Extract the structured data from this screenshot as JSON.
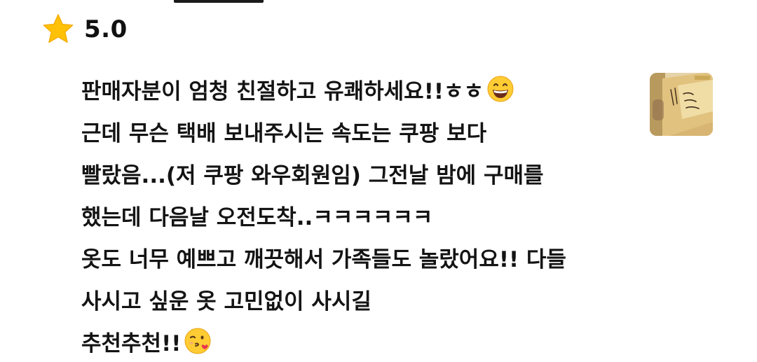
{
  "review": {
    "rating": "5.0",
    "lines": [
      "판매자분이 엄청 친절하고 유쾌하세요!!ㅎㅎ",
      "근데 무슨 택배 보내주시는 속도는 쿠팡 보다",
      "빨랐음...(저 쿠팡 와우회원임) 그전날 밤에 구매를",
      "했는데 다음날 오전도착..ㅋㅋㅋㅋㅋㅋ",
      "옷도 너무 예쁘고 깨끗해서 가족들도 놀랐어요!! 다들",
      "사시고 싶운 옷 고민없이 사시길",
      "추천추천!!"
    ],
    "emojis": {
      "line1": "grinning-face-emoji",
      "line7": "face-blowing-kiss-emoji"
    },
    "thumbnail_icon": "review-photo-thumbnail"
  },
  "colors": {
    "star": "#FFC107",
    "text": "#141414",
    "background": "#FFFFFF"
  }
}
